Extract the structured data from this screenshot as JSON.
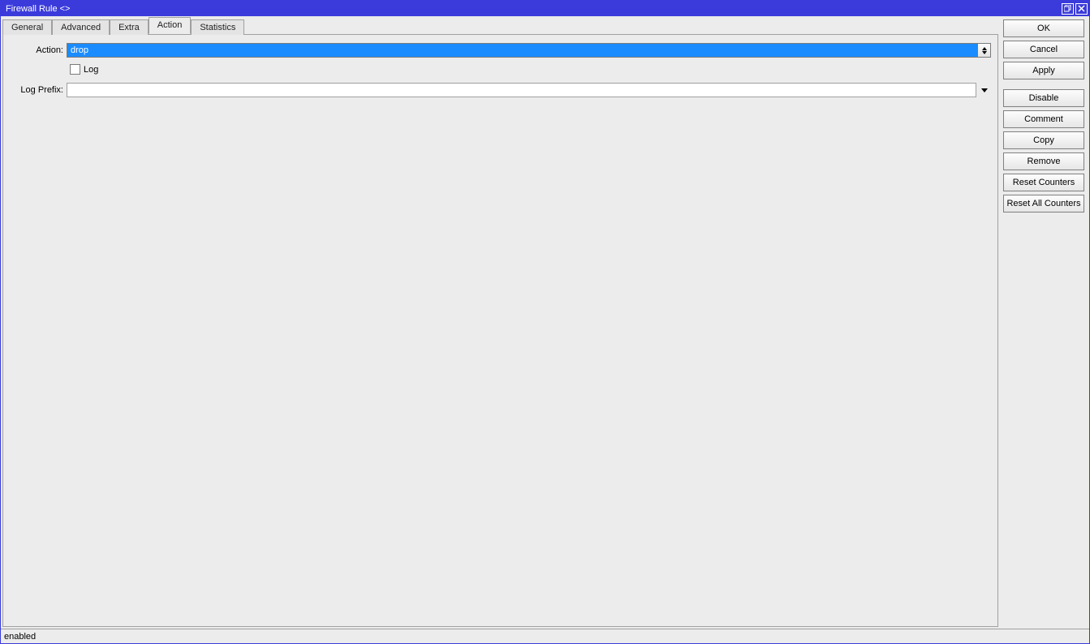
{
  "window": {
    "title": "Firewall Rule <>"
  },
  "tabs": {
    "general": "General",
    "advanced": "Advanced",
    "extra": "Extra",
    "action": "Action",
    "statistics": "Statistics"
  },
  "form": {
    "action_label": "Action:",
    "action_value": "drop",
    "log_label": "Log",
    "log_prefix_label": "Log Prefix:",
    "log_prefix_value": ""
  },
  "buttons": {
    "ok": "OK",
    "cancel": "Cancel",
    "apply": "Apply",
    "disable": "Disable",
    "comment": "Comment",
    "copy": "Copy",
    "remove": "Remove",
    "reset_counters": "Reset Counters",
    "reset_all_counters": "Reset All Counters"
  },
  "status": {
    "text": "enabled"
  }
}
